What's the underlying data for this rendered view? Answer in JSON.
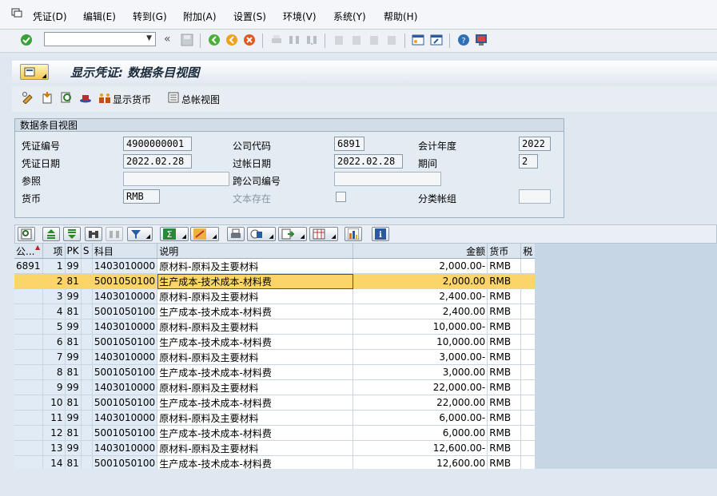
{
  "menu": {
    "items": [
      "凭证(D)",
      "编辑(E)",
      "转到(G)",
      "附加(A)",
      "设置(S)",
      "环境(V)",
      "系统(Y)",
      "帮助(H)"
    ]
  },
  "title": "显示凭证: 数据条目视图",
  "app_toolbar": {
    "show_currency": "显示货币",
    "ledger_view": "总帐视图"
  },
  "header": {
    "group_title": "数据条目视图",
    "doc_no_label": "凭证编号",
    "doc_no": "4900000001",
    "company_label": "公司代码",
    "company": "6891",
    "fiscal_year_label": "会计年度",
    "fiscal_year": "2022",
    "doc_date_label": "凭证日期",
    "doc_date": "2022.02.28",
    "post_date_label": "过帐日期",
    "post_date": "2022.02.28",
    "period_label": "期间",
    "period": "2",
    "reference_label": "参照",
    "reference": "",
    "cross_cc_label": "跨公司编号",
    "cross_cc": "",
    "currency_label": "货币",
    "currency": "RMB",
    "text_exists_label": "文本存在",
    "ledger_group_label": "分类帐组",
    "ledger_group": ""
  },
  "table": {
    "columns": [
      "公...",
      "项",
      "PK",
      "S",
      "科目",
      "说明",
      "金额",
      "货币",
      "税"
    ],
    "rows": [
      {
        "cc": "6891",
        "item": "1",
        "pk": "99",
        "s": "",
        "acct": "1403010000",
        "desc": "原材料-原料及主要材料",
        "amt": "2,000.00-",
        "cur": "RMB",
        "tax": ""
      },
      {
        "cc": "",
        "item": "2",
        "pk": "81",
        "s": "",
        "acct": "5001050100",
        "desc": "生产成本-技术成本-材料费",
        "amt": "2,000.00",
        "cur": "RMB",
        "tax": ""
      },
      {
        "cc": "",
        "item": "3",
        "pk": "99",
        "s": "",
        "acct": "1403010000",
        "desc": "原材料-原料及主要材料",
        "amt": "2,400.00-",
        "cur": "RMB",
        "tax": ""
      },
      {
        "cc": "",
        "item": "4",
        "pk": "81",
        "s": "",
        "acct": "5001050100",
        "desc": "生产成本-技术成本-材料费",
        "amt": "2,400.00",
        "cur": "RMB",
        "tax": ""
      },
      {
        "cc": "",
        "item": "5",
        "pk": "99",
        "s": "",
        "acct": "1403010000",
        "desc": "原材料-原料及主要材料",
        "amt": "10,000.00-",
        "cur": "RMB",
        "tax": ""
      },
      {
        "cc": "",
        "item": "6",
        "pk": "81",
        "s": "",
        "acct": "5001050100",
        "desc": "生产成本-技术成本-材料费",
        "amt": "10,000.00",
        "cur": "RMB",
        "tax": ""
      },
      {
        "cc": "",
        "item": "7",
        "pk": "99",
        "s": "",
        "acct": "1403010000",
        "desc": "原材料-原料及主要材料",
        "amt": "3,000.00-",
        "cur": "RMB",
        "tax": ""
      },
      {
        "cc": "",
        "item": "8",
        "pk": "81",
        "s": "",
        "acct": "5001050100",
        "desc": "生产成本-技术成本-材料费",
        "amt": "3,000.00",
        "cur": "RMB",
        "tax": ""
      },
      {
        "cc": "",
        "item": "9",
        "pk": "99",
        "s": "",
        "acct": "1403010000",
        "desc": "原材料-原料及主要材料",
        "amt": "22,000.00-",
        "cur": "RMB",
        "tax": ""
      },
      {
        "cc": "",
        "item": "10",
        "pk": "81",
        "s": "",
        "acct": "5001050100",
        "desc": "生产成本-技术成本-材料费",
        "amt": "22,000.00",
        "cur": "RMB",
        "tax": ""
      },
      {
        "cc": "",
        "item": "11",
        "pk": "99",
        "s": "",
        "acct": "1403010000",
        "desc": "原材料-原料及主要材料",
        "amt": "6,000.00-",
        "cur": "RMB",
        "tax": ""
      },
      {
        "cc": "",
        "item": "12",
        "pk": "81",
        "s": "",
        "acct": "5001050100",
        "desc": "生产成本-技术成本-材料费",
        "amt": "6,000.00",
        "cur": "RMB",
        "tax": ""
      },
      {
        "cc": "",
        "item": "13",
        "pk": "99",
        "s": "",
        "acct": "1403010000",
        "desc": "原材料-原料及主要材料",
        "amt": "12,600.00-",
        "cur": "RMB",
        "tax": ""
      },
      {
        "cc": "",
        "item": "14",
        "pk": "81",
        "s": "",
        "acct": "5001050100",
        "desc": "生产成本-技术成本-材料费",
        "amt": "12,600.00",
        "cur": "RMB",
        "tax": ""
      }
    ]
  },
  "colors": {
    "selected_row": "#fbd46a",
    "key_column": "#e0ebf5",
    "title_text": "#1a2a3a"
  }
}
